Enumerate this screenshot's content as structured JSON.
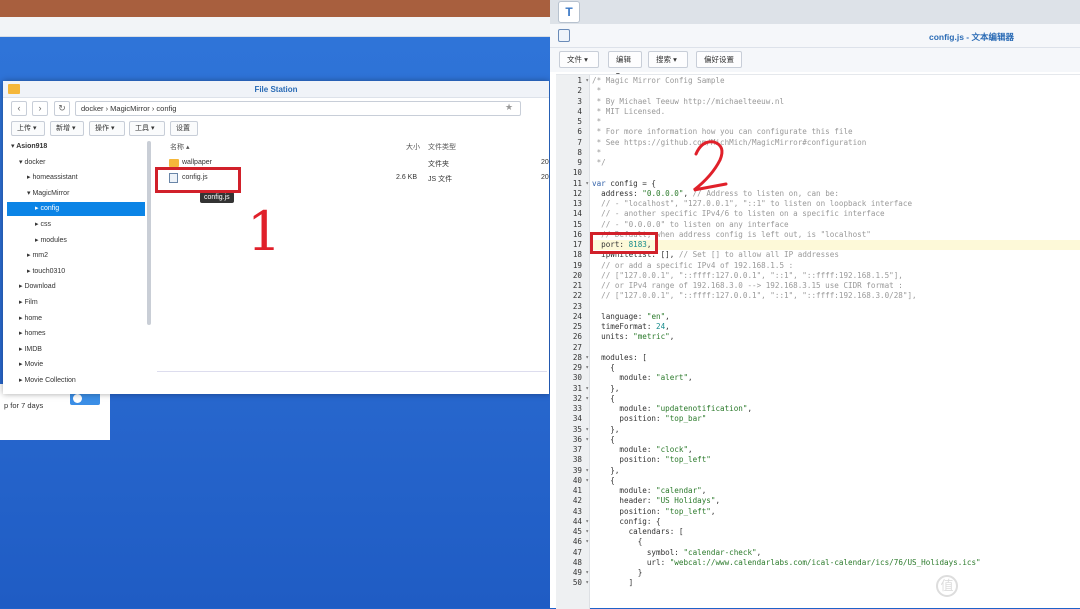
{
  "file_station": {
    "title": "File Station",
    "path": "docker  ›  MagicMirror  ›  config",
    "toolbar": [
      "上传 ▾",
      "新增 ▾",
      "操作 ▾",
      "工具 ▾",
      "设置"
    ],
    "tree": [
      {
        "label": "▾ Asion918",
        "bold": true
      },
      {
        "label": "▾ docker"
      },
      {
        "label": "▸ homeassistant"
      },
      {
        "label": "▾ MagicMirror"
      },
      {
        "label": "▸ config",
        "selected": true
      },
      {
        "label": "▸ css"
      },
      {
        "label": "▸ modules"
      },
      {
        "label": "▸ mm2"
      },
      {
        "label": "▸ touch0310"
      },
      {
        "label": "▸ Download"
      },
      {
        "label": "▸ Film"
      },
      {
        "label": "▸ home"
      },
      {
        "label": "▸ homes"
      },
      {
        "label": "▸ IMDB"
      },
      {
        "label": "▸ Movie"
      },
      {
        "label": "▸ Movie Collection"
      }
    ],
    "columns": {
      "name": "名称 ▴",
      "size": "大小",
      "type": "文件类型"
    },
    "rows": [
      {
        "name": "wallpaper",
        "size": "",
        "type": "文件夹",
        "date": "20"
      },
      {
        "name": "config.js",
        "size": "2.6 KB",
        "type": "JS 文件",
        "date": "20"
      }
    ],
    "tooltip": "config.js"
  },
  "background_panel": {
    "text": "p for 7 days"
  },
  "annotations": {
    "one": "1",
    "two": "2"
  },
  "editor": {
    "title": "config.js - 文本编辑器",
    "menu": [
      "文件 ▾",
      "编辑 ▾",
      "搜索 ▾",
      "偏好设置"
    ],
    "highlight_line": 17,
    "lines": [
      {
        "n": "1",
        "fold": true,
        "t": [
          [
            "c",
            "/* Magic Mirror Config Sample"
          ]
        ]
      },
      {
        "n": "2",
        "t": [
          [
            "c",
            " *"
          ]
        ]
      },
      {
        "n": "3",
        "t": [
          [
            "c",
            " * By Michael Teeuw http://michaelteeuw.nl"
          ]
        ]
      },
      {
        "n": "4",
        "t": [
          [
            "c",
            " * MIT Licensed."
          ]
        ]
      },
      {
        "n": "5",
        "t": [
          [
            "c",
            " *"
          ]
        ]
      },
      {
        "n": "6",
        "t": [
          [
            "c",
            " * For more information how you can configurate this file"
          ]
        ]
      },
      {
        "n": "7",
        "t": [
          [
            "c",
            " * See https://github.com/MichMich/MagicMirror#configuration"
          ]
        ]
      },
      {
        "n": "8",
        "t": [
          [
            "c",
            " *"
          ]
        ]
      },
      {
        "n": "9",
        "t": [
          [
            "c",
            " */"
          ]
        ]
      },
      {
        "n": "10",
        "t": []
      },
      {
        "n": "11",
        "fold": true,
        "t": [
          [
            "k",
            "var"
          ],
          [
            "",
            " config = {"
          ]
        ]
      },
      {
        "n": "12",
        "t": [
          [
            "",
            "  address: "
          ],
          [
            "s",
            "\"0.0.0.0\""
          ],
          [
            "",
            ", "
          ],
          [
            "c",
            "// Address to listen on, can be:"
          ]
        ]
      },
      {
        "n": "13",
        "t": [
          [
            "c",
            "  // - \"localhost\", \"127.0.0.1\", \"::1\" to listen on loopback interface"
          ]
        ]
      },
      {
        "n": "14",
        "t": [
          [
            "c",
            "  // - another specific IPv4/6 to listen on a specific interface"
          ]
        ]
      },
      {
        "n": "15",
        "t": [
          [
            "c",
            "  // - \"0.0.0.0\" to listen on any interface"
          ]
        ]
      },
      {
        "n": "16",
        "t": [
          [
            "c",
            "  // Default, when address config is left out, is \"localhost\""
          ]
        ]
      },
      {
        "n": "17",
        "t": [
          [
            "",
            "  port: "
          ],
          [
            "n",
            "8183"
          ],
          [
            "",
            ","
          ]
        ]
      },
      {
        "n": "18",
        "t": [
          [
            "",
            "  ipWhitelist: [], "
          ],
          [
            "c",
            "// Set [] to allow all IP addresses"
          ]
        ]
      },
      {
        "n": "19",
        "t": [
          [
            "c",
            "  // or add a specific IPv4 of 192.168.1.5 :"
          ]
        ]
      },
      {
        "n": "20",
        "t": [
          [
            "c",
            "  // [\"127.0.0.1\", \"::ffff:127.0.0.1\", \"::1\", \"::ffff:192.168.1.5\"],"
          ]
        ]
      },
      {
        "n": "21",
        "t": [
          [
            "c",
            "  // or IPv4 range of 192.168.3.0 --> 192.168.3.15 use CIDR format :"
          ]
        ]
      },
      {
        "n": "22",
        "t": [
          [
            "c",
            "  // [\"127.0.0.1\", \"::ffff:127.0.0.1\", \"::1\", \"::ffff:192.168.3.0/28\"],"
          ]
        ]
      },
      {
        "n": "23",
        "t": []
      },
      {
        "n": "24",
        "t": [
          [
            "",
            "  language: "
          ],
          [
            "s",
            "\"en\""
          ],
          [
            "",
            ","
          ]
        ]
      },
      {
        "n": "25",
        "t": [
          [
            "",
            "  timeFormat: "
          ],
          [
            "n",
            "24"
          ],
          [
            "",
            ","
          ]
        ]
      },
      {
        "n": "26",
        "t": [
          [
            "",
            "  units: "
          ],
          [
            "s",
            "\"metric\""
          ],
          [
            "",
            ","
          ]
        ]
      },
      {
        "n": "27",
        "t": []
      },
      {
        "n": "28",
        "fold": true,
        "t": [
          [
            "",
            "  modules: ["
          ]
        ]
      },
      {
        "n": "29",
        "fold": true,
        "t": [
          [
            "",
            "    {"
          ]
        ]
      },
      {
        "n": "30",
        "t": [
          [
            "",
            "      module: "
          ],
          [
            "s",
            "\"alert\""
          ],
          [
            "",
            ","
          ]
        ]
      },
      {
        "n": "31",
        "fold": true,
        "t": [
          [
            "",
            "    },"
          ]
        ]
      },
      {
        "n": "32",
        "fold": true,
        "t": [
          [
            "",
            "    {"
          ]
        ]
      },
      {
        "n": "33",
        "t": [
          [
            "",
            "      module: "
          ],
          [
            "s",
            "\"updatenotification\""
          ],
          [
            "",
            ","
          ]
        ]
      },
      {
        "n": "34",
        "t": [
          [
            "",
            "      position: "
          ],
          [
            "s",
            "\"top_bar\""
          ]
        ]
      },
      {
        "n": "35",
        "fold": true,
        "t": [
          [
            "",
            "    },"
          ]
        ]
      },
      {
        "n": "36",
        "fold": true,
        "t": [
          [
            "",
            "    {"
          ]
        ]
      },
      {
        "n": "37",
        "t": [
          [
            "",
            "      module: "
          ],
          [
            "s",
            "\"clock\""
          ],
          [
            "",
            ","
          ]
        ]
      },
      {
        "n": "38",
        "t": [
          [
            "",
            "      position: "
          ],
          [
            "s",
            "\"top_left\""
          ]
        ]
      },
      {
        "n": "39",
        "fold": true,
        "t": [
          [
            "",
            "    },"
          ]
        ]
      },
      {
        "n": "40",
        "fold": true,
        "t": [
          [
            "",
            "    {"
          ]
        ]
      },
      {
        "n": "41",
        "t": [
          [
            "",
            "      module: "
          ],
          [
            "s",
            "\"calendar\""
          ],
          [
            "",
            ","
          ]
        ]
      },
      {
        "n": "42",
        "t": [
          [
            "",
            "      header: "
          ],
          [
            "s",
            "\"US Holidays\""
          ],
          [
            "",
            ","
          ]
        ]
      },
      {
        "n": "43",
        "t": [
          [
            "",
            "      position: "
          ],
          [
            "s",
            "\"top_left\""
          ],
          [
            "",
            ","
          ]
        ]
      },
      {
        "n": "44",
        "fold": true,
        "t": [
          [
            "",
            "      config: {"
          ]
        ]
      },
      {
        "n": "45",
        "fold": true,
        "t": [
          [
            "",
            "        calendars: ["
          ]
        ]
      },
      {
        "n": "46",
        "fold": true,
        "t": [
          [
            "",
            "          {"
          ]
        ]
      },
      {
        "n": "47",
        "t": [
          [
            "",
            "            symbol: "
          ],
          [
            "s",
            "\"calendar-check\""
          ],
          [
            "",
            ","
          ]
        ]
      },
      {
        "n": "48",
        "t": [
          [
            "",
            "            url: "
          ],
          [
            "s",
            "\"webcal://www.calendarlabs.com/ical-calendar/ics/76/US_Holidays.ics\""
          ]
        ]
      },
      {
        "n": "49",
        "fold": true,
        "t": [
          [
            "",
            "          }"
          ]
        ]
      },
      {
        "n": "50",
        "fold": true,
        "t": [
          [
            "",
            "        ]"
          ]
        ]
      }
    ]
  },
  "watermark": "什么值得买",
  "watermark_icon": "值",
  "colors": {
    "accent": "#0b84e6",
    "annotation_red": "#d1202a",
    "desktop": "#2a6ad0"
  }
}
